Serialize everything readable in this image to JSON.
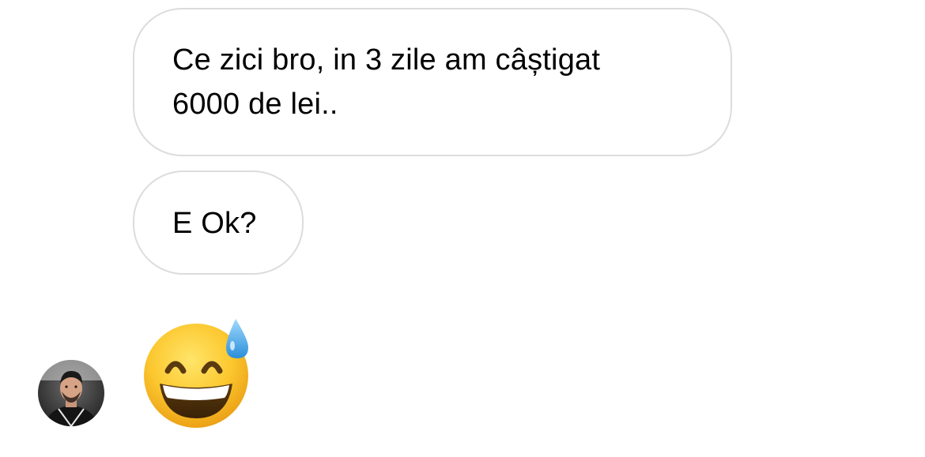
{
  "conversation": {
    "messages": [
      {
        "text": "Ce zici bro, in 3 zile am câștigat\n6000 de lei.."
      },
      {
        "text": "E Ok?"
      }
    ],
    "reaction": {
      "icon": "grinning-face-with-sweat-emoji"
    },
    "sender": {
      "avatar_icon": "user-avatar"
    }
  },
  "colors": {
    "bubble_border": "#dcdcdc",
    "text": "#000000",
    "background": "#ffffff",
    "emoji_face": "#f8c02a",
    "sweat_drop": "#4aa8e6"
  }
}
